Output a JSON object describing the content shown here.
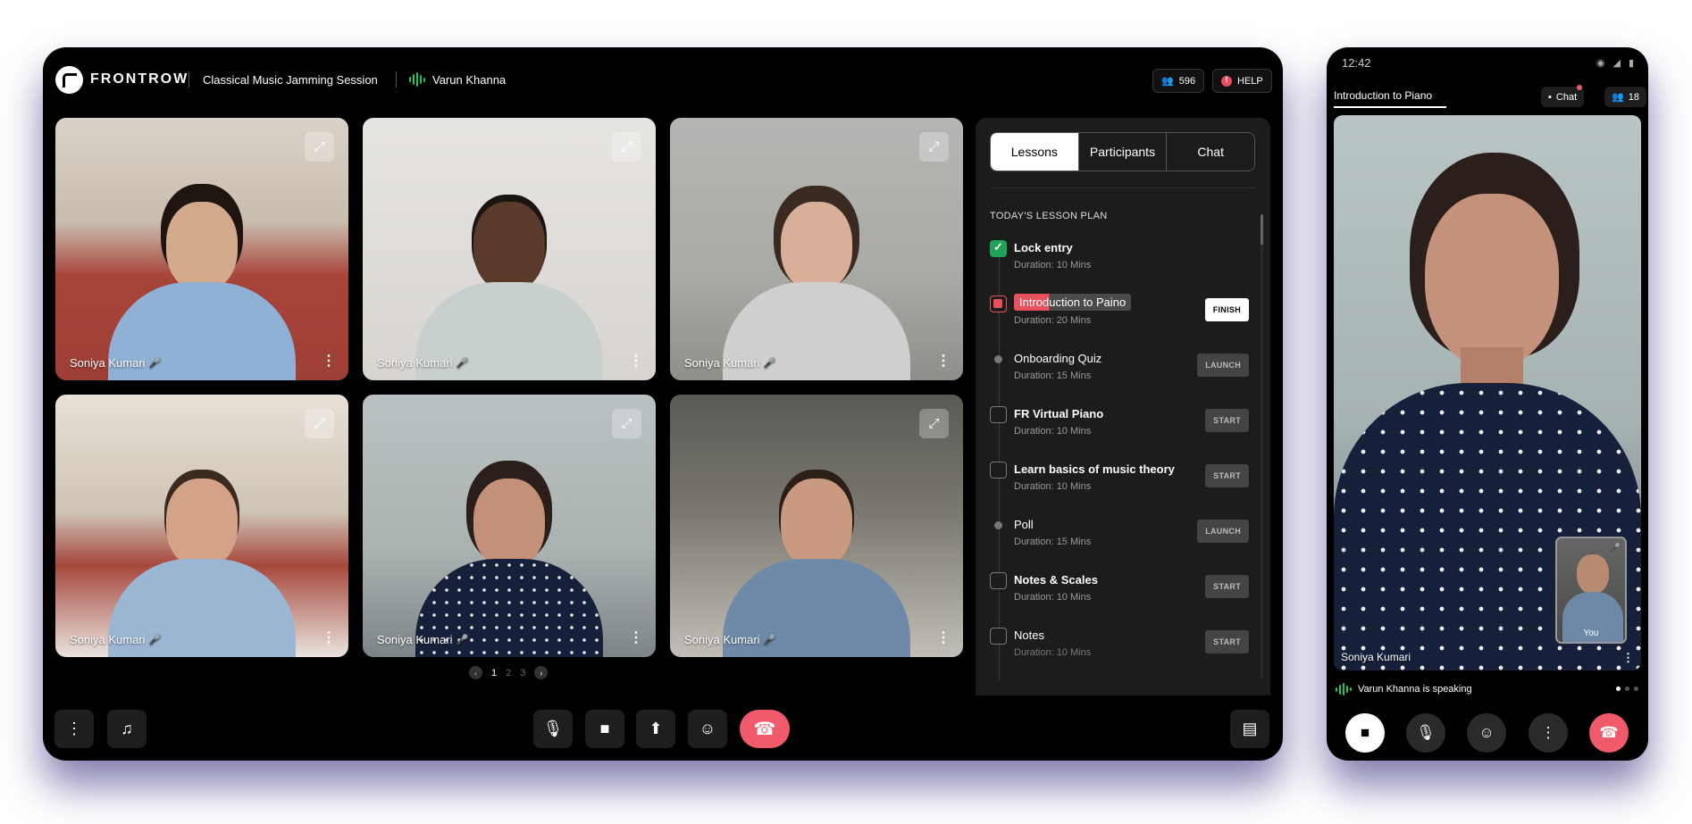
{
  "desktop": {
    "brand": "FRONTROW",
    "session_title": "Classical Music Jamming Session",
    "active_speaker": "Varun Khanna",
    "participant_count": "596",
    "help_label": "HELP",
    "tiles": [
      {
        "name": "Soniya Kumari"
      },
      {
        "name": "Soniya Kumari"
      },
      {
        "name": "Soniya Kumari"
      },
      {
        "name": "Soniya Kumari"
      },
      {
        "name": "Soniya Kumari"
      },
      {
        "name": "Soniya Kumari"
      }
    ],
    "pagination": {
      "current": "1",
      "pages": [
        "1",
        "2",
        "3"
      ]
    },
    "panel": {
      "tabs": [
        "Lessons",
        "Participants",
        "Chat"
      ],
      "active_tab": "Lessons",
      "plan_title": "TODAY'S LESSON PLAN",
      "lessons": [
        {
          "title": "Lock entry",
          "duration": "Duration: 10 Mins",
          "state": "done",
          "action": ""
        },
        {
          "title": "Introduction to Paino",
          "duration": "Duration: 20 Mins",
          "state": "active",
          "action": "FINISH"
        },
        {
          "title": "Onboarding Quiz",
          "duration": "Duration: 15 Mins",
          "state": "dot",
          "action": "LAUNCH"
        },
        {
          "title": "FR Virtual Piano",
          "duration": "Duration: 10 Mins",
          "state": "todo",
          "action": "START"
        },
        {
          "title": "Learn basics of music theory",
          "duration": "Duration: 10 Mins",
          "state": "todo",
          "action": "START"
        },
        {
          "title": "Poll",
          "duration": "Duration: 15 Mins",
          "state": "dot",
          "action": "LAUNCH"
        },
        {
          "title": "Notes & Scales",
          "duration": "Duration: 10 Mins",
          "state": "todo",
          "action": "START"
        },
        {
          "title": "Notes",
          "duration": "Duration: 10 Mins",
          "state": "todo",
          "action": "START"
        }
      ]
    },
    "toolbar_icons": [
      "more-icon",
      "music-library-icon",
      "microphone-icon",
      "camera-icon",
      "share-screen-icon",
      "reaction-icon",
      "end-call-icon",
      "chat-icon"
    ]
  },
  "mobile": {
    "time": "12:42",
    "tab_title": "Introduction to Piano",
    "chat_label": "Chat",
    "participant_count": "18",
    "main_video_name": "Soniya Kumari",
    "self_label": "You",
    "speaking_status": "Varun Khanna is speaking"
  },
  "colors": {
    "accent_red": "#f05a6a",
    "success_green": "#1fa35a",
    "speaking_green": "#22c55e"
  }
}
